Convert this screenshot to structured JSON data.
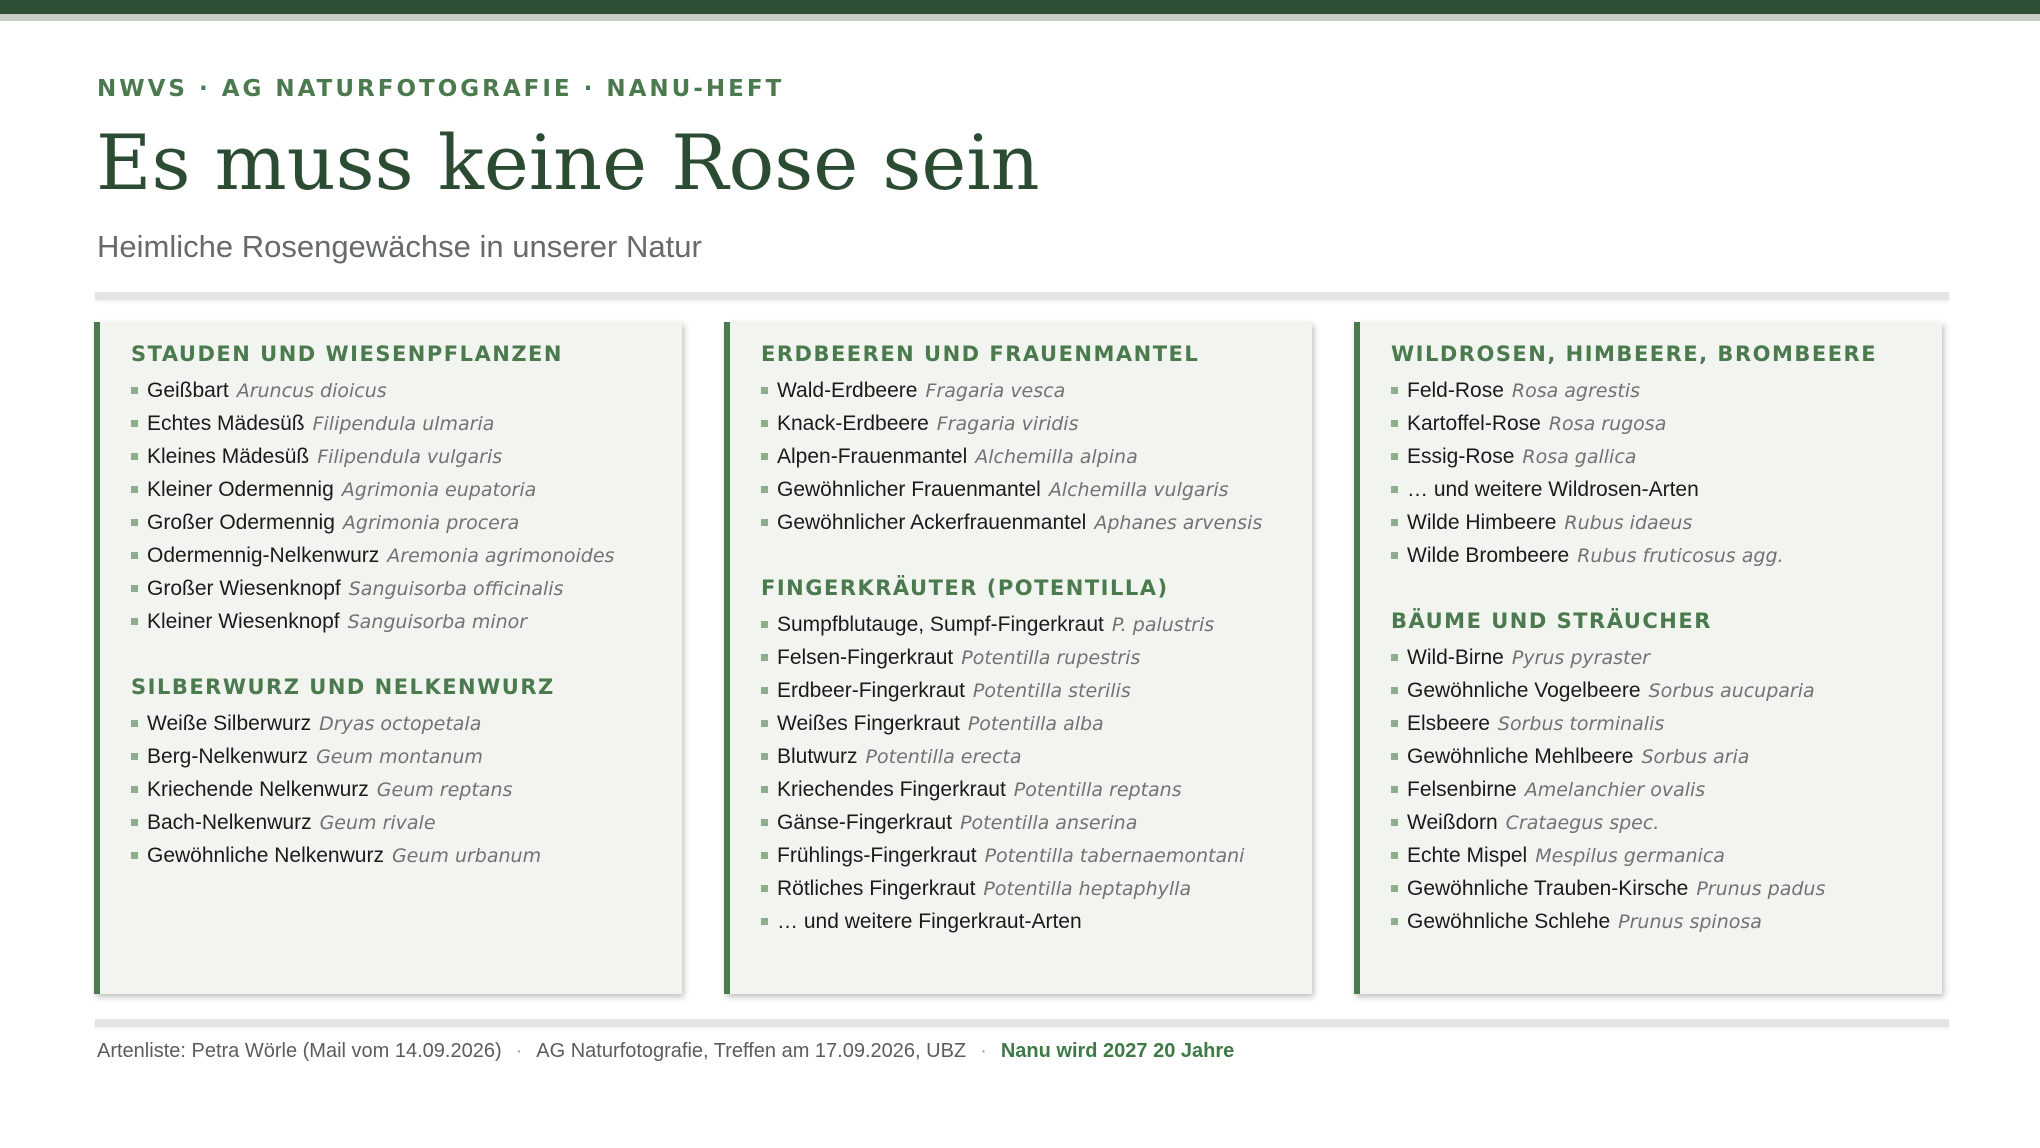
{
  "header": {
    "kicker": "NWVS · AG NATURFOTOGRAFIE · NANU-HEFT",
    "title": "Es muss keine Rose sein",
    "subtitle": "Heimliche Rosengewächse in unserer Natur"
  },
  "columns": [
    {
      "sections": [
        {
          "heading": "STAUDEN UND WIESENPFLANZEN",
          "items": [
            {
              "name": "Geißbart",
              "sci": "Aruncus dioicus"
            },
            {
              "name": "Echtes Mädesüß",
              "sci": "Filipendula ulmaria"
            },
            {
              "name": "Kleines Mädesüß",
              "sci": "Filipendula vulgaris"
            },
            {
              "name": "Kleiner Odermennig",
              "sci": "Agrimonia eupatoria"
            },
            {
              "name": "Großer Odermennig",
              "sci": "Agrimonia procera"
            },
            {
              "name": "Odermennig-Nelkenwurz",
              "sci": "Aremonia agrimonoides"
            },
            {
              "name": "Großer Wiesenknopf",
              "sci": "Sanguisorba officinalis"
            },
            {
              "name": "Kleiner Wiesenknopf",
              "sci": "Sanguisorba minor"
            }
          ]
        },
        {
          "heading": "SILBERWURZ UND NELKENWURZ",
          "items": [
            {
              "name": "Weiße Silberwurz",
              "sci": "Dryas octopetala"
            },
            {
              "name": "Berg-Nelkenwurz",
              "sci": "Geum montanum"
            },
            {
              "name": "Kriechende Nelkenwurz",
              "sci": "Geum reptans"
            },
            {
              "name": "Bach-Nelkenwurz",
              "sci": "Geum rivale"
            },
            {
              "name": "Gewöhnliche Nelkenwurz",
              "sci": "Geum urbanum"
            }
          ]
        }
      ]
    },
    {
      "sections": [
        {
          "heading": "ERDBEEREN UND FRAUENMANTEL",
          "items": [
            {
              "name": "Wald-Erdbeere",
              "sci": "Fragaria vesca"
            },
            {
              "name": "Knack-Erdbeere",
              "sci": "Fragaria viridis"
            },
            {
              "name": "Alpen-Frauenmantel",
              "sci": "Alchemilla alpina"
            },
            {
              "name": "Gewöhnlicher Frauenmantel",
              "sci": "Alchemilla vulgaris"
            },
            {
              "name": "Gewöhnlicher Ackerfrauenmantel",
              "sci": "Aphanes arvensis"
            }
          ]
        },
        {
          "heading": "FINGERKRÄUTER (POTENTILLA)",
          "items": [
            {
              "name": "Sumpfblutauge, Sumpf-Fingerkraut",
              "sci": "P. palustris"
            },
            {
              "name": "Felsen-Fingerkraut",
              "sci": "Potentilla rupestris"
            },
            {
              "name": "Erdbeer-Fingerkraut",
              "sci": "Potentilla sterilis"
            },
            {
              "name": "Weißes Fingerkraut",
              "sci": "Potentilla alba"
            },
            {
              "name": "Blutwurz",
              "sci": "Potentilla erecta"
            },
            {
              "name": "Kriechendes Fingerkraut",
              "sci": "Potentilla reptans"
            },
            {
              "name": "Gänse-Fingerkraut",
              "sci": "Potentilla anserina"
            },
            {
              "name": "Frühlings-Fingerkraut",
              "sci": "Potentilla tabernaemontani"
            },
            {
              "name": "Rötliches Fingerkraut",
              "sci": "Potentilla heptaphylla"
            },
            {
              "name": "… und weitere Fingerkraut-Arten",
              "sci": ""
            }
          ]
        }
      ]
    },
    {
      "sections": [
        {
          "heading": "WILDROSEN, HIMBEERE, BROMBEERE",
          "items": [
            {
              "name": "Feld-Rose",
              "sci": "Rosa agrestis"
            },
            {
              "name": "Kartoffel-Rose",
              "sci": "Rosa rugosa"
            },
            {
              "name": "Essig-Rose",
              "sci": "Rosa gallica"
            },
            {
              "name": "… und weitere Wildrosen-Arten",
              "sci": ""
            },
            {
              "name": "Wilde Himbeere",
              "sci": "Rubus idaeus"
            },
            {
              "name": "Wilde Brombeere",
              "sci": "Rubus fruticosus agg."
            }
          ]
        },
        {
          "heading": "BÄUME UND STRÄUCHER",
          "items": [
            {
              "name": "Wild-Birne",
              "sci": "Pyrus pyraster"
            },
            {
              "name": "Gewöhnliche Vogelbeere",
              "sci": "Sorbus aucuparia"
            },
            {
              "name": "Elsbeere",
              "sci": "Sorbus torminalis"
            },
            {
              "name": "Gewöhnliche Mehlbeere",
              "sci": "Sorbus aria"
            },
            {
              "name": "Felsenbirne",
              "sci": "Amelanchier ovalis"
            },
            {
              "name": "Weißdorn",
              "sci": "Crataegus spec."
            },
            {
              "name": "Echte Mispel",
              "sci": "Mespilus germanica"
            },
            {
              "name": "Gewöhnliche Trauben-Kirsche",
              "sci": "Prunus padus"
            },
            {
              "name": "Gewöhnliche Schlehe",
              "sci": "Prunus spinosa"
            }
          ]
        }
      ]
    }
  ],
  "footer": {
    "source": "Artenliste: Petra Wörle (Mail vom 14.09.2026)",
    "separator": "·",
    "meeting": "AG Naturfotografie, Treffen am 17.09.2026, UBZ",
    "anniversary": "Nanu wird 2027 20 Jahre"
  },
  "colors": {
    "accent_green": "#4b7a4e",
    "title_green": "#2b4c33",
    "panel_bg": "#f2f4f0"
  }
}
